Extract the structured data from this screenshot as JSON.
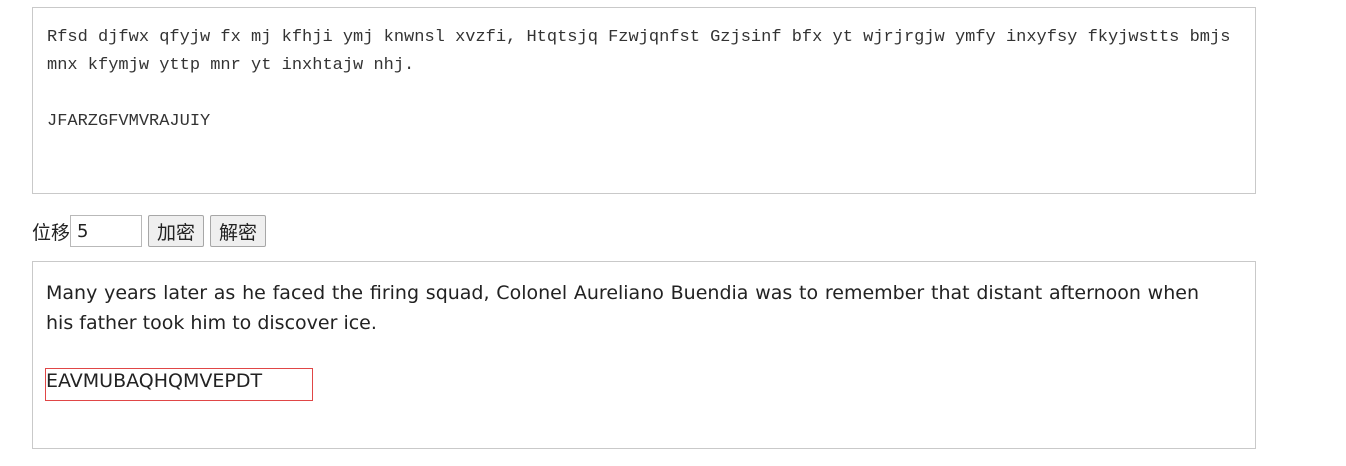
{
  "cipher_panel": {
    "text": "Rfsd djfwx qfyjw fx mj kfhji ymj knwnsl xvzfi, Htqtsjq Fzwjqnfst Gzjsinf bfx yt wjrjrgjw ymfy inxyfsy fkyjwstts bmjs mnx kfymjw yttp mnr yt inxhtajw nhj.",
    "key": "JFARZGFVMVRAJUIY"
  },
  "controls": {
    "shift_label": "位移",
    "shift_value": "5",
    "encrypt_label": "加密",
    "decrypt_label": "解密"
  },
  "plain_panel": {
    "text": "Many years later as he faced the firing squad, Colonel Aureliano Buendia was to remember that distant afternoon when his father took him to discover ice.",
    "key": "EAVMUBAQHQMVEPDT"
  }
}
